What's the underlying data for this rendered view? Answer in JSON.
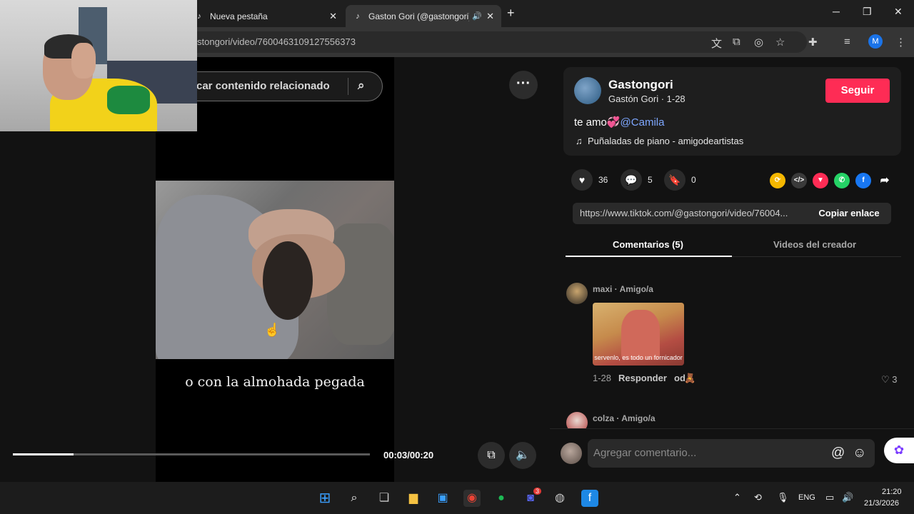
{
  "browser": {
    "tabs": [
      {
        "title": "Nueva pestaña",
        "active": false
      },
      {
        "title": "Gaston Gori (@gastongori)",
        "active": true,
        "audio": true
      }
    ],
    "url": "stongori/video/7600463109127556373"
  },
  "video": {
    "search_text": "car contenido relacionado",
    "caption": "o con la almohada pegada",
    "timestamp": "00:03/00:20",
    "progress_fraction": 0.17
  },
  "creator": {
    "username": "Gastongori",
    "subline": "Gastón Gori · 1-28",
    "follow_label": "Seguir",
    "description_text": "te amo💞",
    "mention": "@Camila",
    "music": "Puñaladas de piano - amigodeartistas"
  },
  "actions": {
    "likes": "36",
    "comments": "5",
    "saves": "0"
  },
  "share_link": {
    "url": "https://www.tiktok.com/@gastongori/video/76004...",
    "copy_label": "Copiar enlace"
  },
  "tabs": {
    "comments_label": "Comentarios (5)",
    "creator_videos_label": "Videos del creador"
  },
  "comments": [
    {
      "author": "maxi · Amigo/a",
      "gif_caption": "servenlo, es todo un fornicador",
      "date": "1-28",
      "reply_label": "Responder",
      "badge": "od",
      "likes": "3"
    },
    {
      "author": "colza · Amigo/a"
    }
  ],
  "comment_input": {
    "placeholder": "Agregar comentario..."
  },
  "taskbar": {
    "language": "ENG",
    "time": "21:20",
    "date": "21/3/2026",
    "discord_badge": "3"
  },
  "colors": {
    "follow": "#fe2c55",
    "mention": "#7ea7ff"
  }
}
